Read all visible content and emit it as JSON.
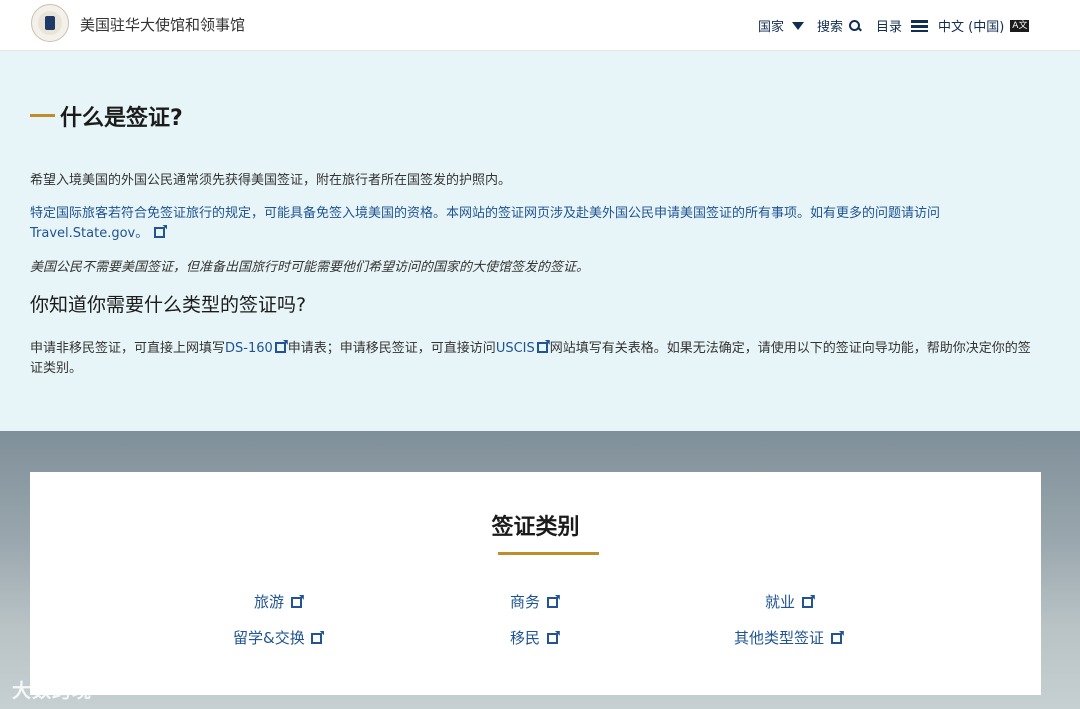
{
  "header": {
    "site_name": "美国驻华大使馆和领事馆",
    "nav": {
      "countries": "国家",
      "search": "搜索",
      "menu": "目录",
      "language": "中文 (中国)",
      "lang_badge": "A文"
    }
  },
  "intro": {
    "title": "什么是签证?",
    "p1": "希望入境美国的外国公民通常须先获得美国签证，附在旅行者所在国签发的护照内。",
    "p2_text": "特定国际旅客若符合免签证旅行的规定，可能具备免签入境美国的资格。本网站的签证网页涉及赴美外国公民申请美国签证的所有事项。如有更多的问题请访问 ",
    "p2_link": "Travel.State.gov",
    "p2_end": "。",
    "p3": "美国公民不需要美国签证，但准备出国旅行时可能需要他们希望访问的国家的大使馆签发的签证。",
    "subtitle": "你知道你需要什么类型的签证吗?",
    "p4_a": "申请非移民签证，可直接上网填写",
    "p4_link1": "DS-160",
    "p4_b": "申请表；申请移民签证，可直接访问",
    "p4_link2": "USCIS",
    "p4_c": "网站填写有关表格。如果无法确定，请使用以下的签证向导功能，帮助你决定你的签证类别。"
  },
  "visa_categories": {
    "title": "签证类别",
    "items": [
      {
        "label": "旅游"
      },
      {
        "label": "商务"
      },
      {
        "label": "就业"
      },
      {
        "label": "留学&交换"
      },
      {
        "label": "移民"
      },
      {
        "label": "其他类型签证"
      }
    ]
  },
  "watermark": "大数跨境",
  "colors": {
    "accent_gold": "#c08c2c",
    "link_blue": "#205493",
    "intro_bg": "#e8f5f8",
    "nav_navy": "#112e51"
  }
}
